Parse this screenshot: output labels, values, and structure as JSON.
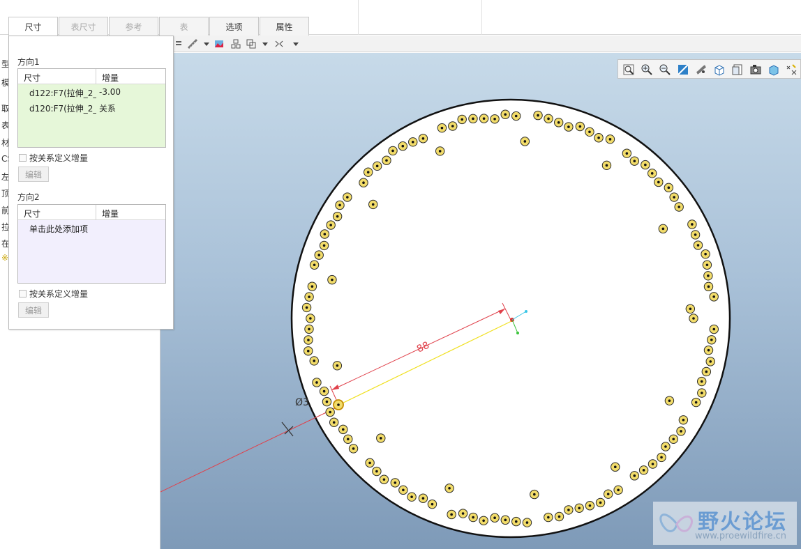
{
  "tabs": [
    {
      "label": "尺寸",
      "state": "active"
    },
    {
      "label": "表尺寸",
      "state": "disabled"
    },
    {
      "label": "参考",
      "state": "disabled"
    },
    {
      "label": "表",
      "state": "disabled"
    },
    {
      "label": "选项",
      "state": "normal"
    },
    {
      "label": "属性",
      "state": "normal"
    }
  ],
  "tree": {
    "items": [
      "型模",
      "模板",
      "取",
      "表院",
      "材",
      "CS",
      "左",
      "顶",
      "前",
      "拉",
      "在",
      "※"
    ]
  },
  "direction1": {
    "title": "方向1",
    "col_dimension": "尺寸",
    "col_increment": "增量",
    "rows": [
      {
        "dimension": "d122:F7(拉伸_2_",
        "increment": "-3.00"
      },
      {
        "dimension": "d120:F7(拉伸_2_",
        "increment": "关系"
      }
    ],
    "checkbox_label": "按关系定义增量",
    "edit_button": "编辑"
  },
  "direction2": {
    "title": "方向2",
    "col_dimension": "尺寸",
    "col_increment": "增量",
    "placeholder_row": "单击此处添加项",
    "checkbox_label": "按关系定义增量",
    "edit_button": "编辑"
  },
  "viewport": {
    "dimension_value": "88",
    "diameter_label": "Ø3",
    "colors": {
      "plate_fill": "#ffffff",
      "hole_fill": "#f2dc6a",
      "dim_red": "#e0404a",
      "axis_yellow": "#f0e020"
    }
  },
  "watermark": {
    "title": "野火论坛",
    "url": "www.proewildfire.cn"
  }
}
